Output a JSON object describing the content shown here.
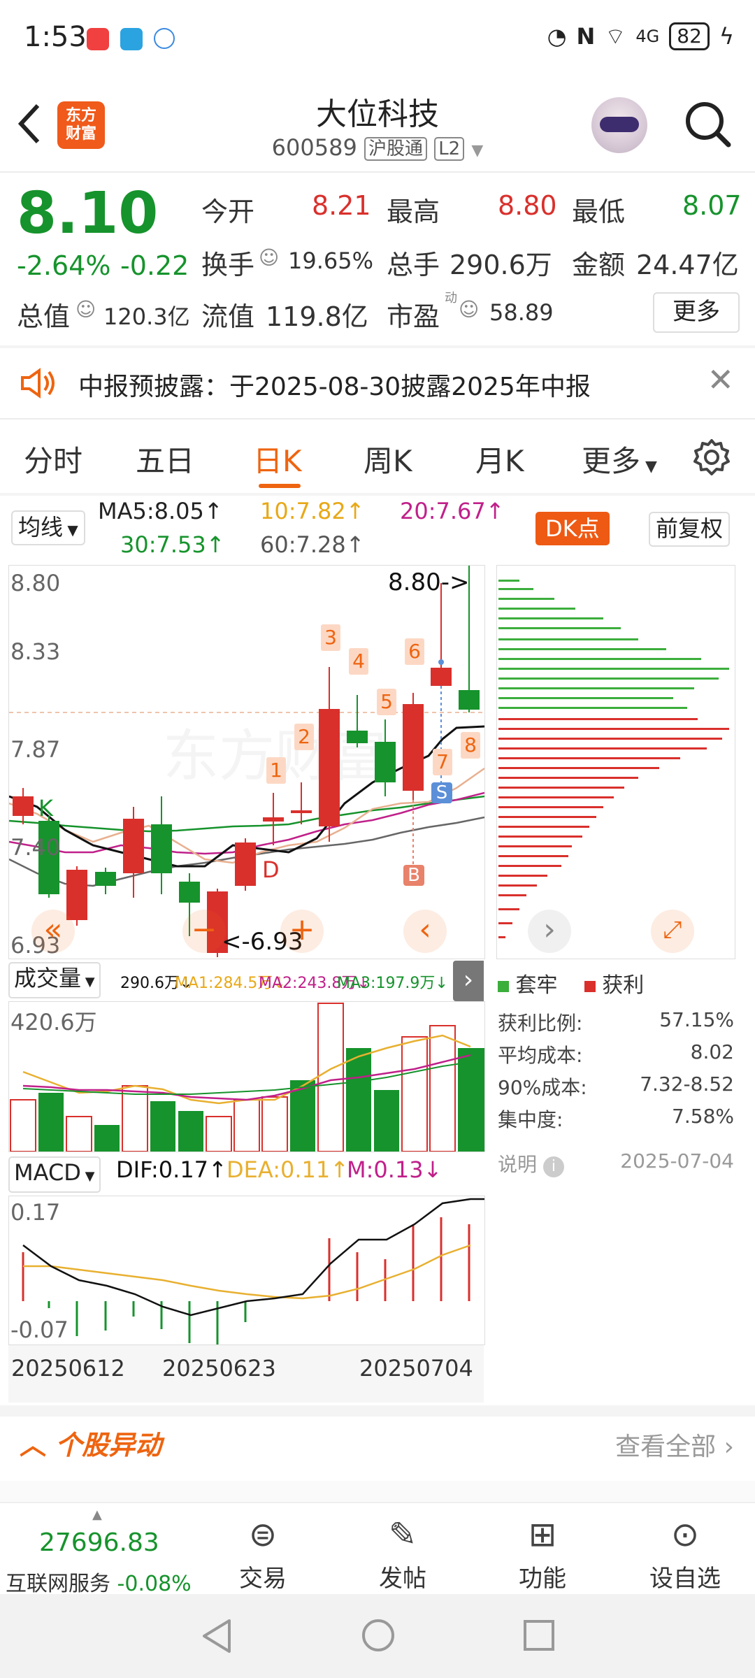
{
  "status_bar": {
    "time": "1:53",
    "battery": "82",
    "network": "4G"
  },
  "header": {
    "stock_name": "大位科技",
    "stock_code": "600589",
    "tag_market": "沪股通",
    "tag_level": "L2",
    "brand_line1": "东方",
    "brand_line2": "财富"
  },
  "quote": {
    "price": "8.10",
    "change_pct": "-2.64%",
    "change_abs": "-0.22",
    "open_label": "今开",
    "open": "8.21",
    "high_label": "最高",
    "high": "8.80",
    "low_label": "最低",
    "low": "8.07",
    "turnover_label": "换手",
    "turnover": "19.65%",
    "volume_label": "总手",
    "volume": "290.6万",
    "amount_label": "金额",
    "amount": "24.47亿",
    "mktcap_label": "总值",
    "mktcap": "120.3亿",
    "float_label": "流值",
    "float": "119.8亿",
    "pe_label": "市盈",
    "pe_sup": "动",
    "pe": "58.89",
    "more": "更多"
  },
  "notice": {
    "text": "中报预披露：于2025-08-30披露2025年中报"
  },
  "tabs": [
    "分时",
    "五日",
    "日K",
    "周K",
    "月K",
    "更多"
  ],
  "ma_bar": {
    "selector": "均线",
    "ma5": "MA5:8.05",
    "ma10": "10:7.82",
    "ma20": "20:7.67",
    "ma30": "30:7.53",
    "ma60": "60:7.28",
    "dk": "DK点",
    "adjust": "前复权"
  },
  "kchart": {
    "price_labels": [
      "8.80",
      "8.33",
      "7.87",
      "7.40",
      "6.93"
    ],
    "high_mark": "8.80->",
    "low_mark": "<-6.93",
    "signal_k": "K",
    "signal_d": "D",
    "signal_b": "B",
    "signal_s": "S",
    "seq_marks": [
      "1",
      "2",
      "3",
      "4",
      "5",
      "6",
      "7",
      "8"
    ]
  },
  "volume_bar": {
    "selector": "成交量",
    "vol": "290.6万",
    "ma1": "MA1:284.5万",
    "ma2": "MA2:243.8万",
    "ma3": "MA3:197.9万",
    "max_label": "420.6万"
  },
  "macd_bar": {
    "selector": "MACD",
    "dif": "DIF:0.17",
    "dea": "DEA:0.11",
    "m": "M:0.13",
    "top_label": "0.17",
    "bottom_label": "-0.07"
  },
  "dates": [
    "20250612",
    "20250623",
    "20250704"
  ],
  "chip": {
    "legend_trapped": "套牢",
    "legend_profit": "获利",
    "rows": [
      {
        "label": "获利比例:",
        "value": "57.15%"
      },
      {
        "label": "平均成本:",
        "value": "8.02"
      },
      {
        "label": "90%成本:",
        "value": "7.32-8.52"
      },
      {
        "label": "集中度:",
        "value": "7.58%"
      }
    ],
    "note": "说明",
    "date": "2025-07-04"
  },
  "movement": {
    "title": "个股异动",
    "view_all": "查看全部"
  },
  "bottom_nav": {
    "index_value": "27696.83",
    "index_name": "互联网服务",
    "index_change": "-0.08%",
    "items": [
      "交易",
      "发帖",
      "功能",
      "设自选"
    ]
  },
  "colors": {
    "up": "#d9302c",
    "down": "#16932c",
    "accent": "#ee6410"
  }
}
